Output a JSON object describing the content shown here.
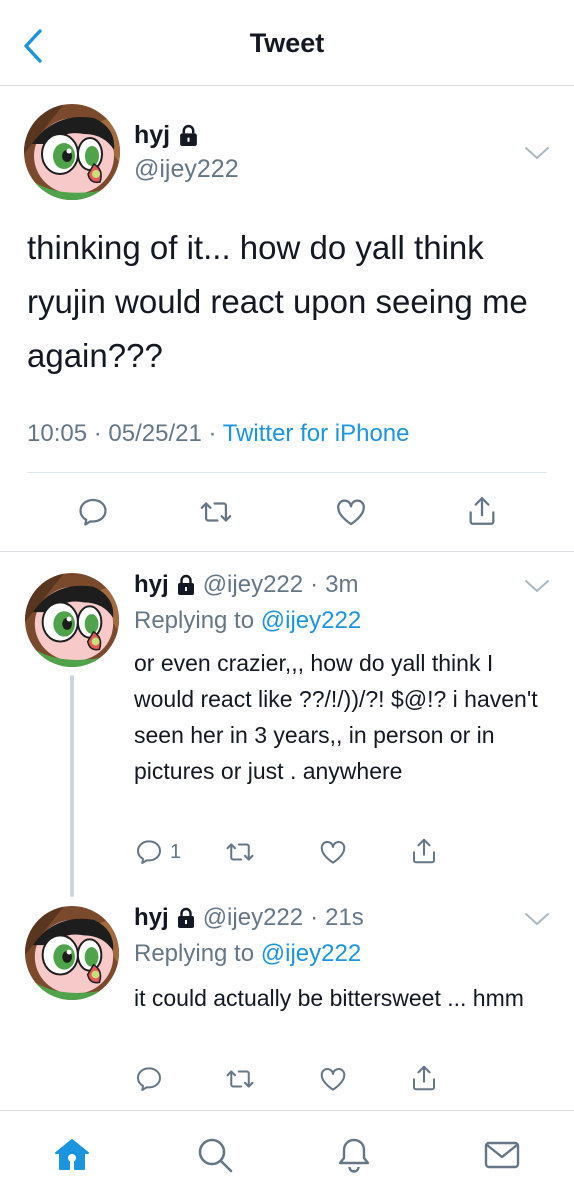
{
  "header": {
    "title": "Tweet"
  },
  "colors": {
    "accent": "#1b95e0",
    "text": "#141823",
    "muted": "#657786",
    "divider": "#d9dde0"
  },
  "main_tweet": {
    "name": "hyj",
    "handle": "@ijey222",
    "text": "thinking of it... how do yall think ryujin would react upon seeing me again???",
    "time": "10:05",
    "date": "05/25/21",
    "source": "Twitter for iPhone",
    "separator": "·"
  },
  "replies": [
    {
      "name": "hyj",
      "handle": "@ijey222",
      "age": "3m",
      "replying_label": "Replying to",
      "replying_to": "@ijey222",
      "text": "or even crazier,,, how do yall think I would react like ??/!/))/?! $@!? i haven't seen her in 3 years,, in person or in pictures or just . anywhere",
      "reply_count": "1"
    },
    {
      "name": "hyj",
      "handle": "@ijey222",
      "age": "21s",
      "replying_label": "Replying to",
      "replying_to": "@ijey222",
      "text": "it could actually be bittersweet ... hmm",
      "reply_count": ""
    }
  ],
  "icons": {
    "back": "chevron-left-icon",
    "lock": "lock-icon",
    "more": "chevron-down-icon",
    "reply": "reply-icon",
    "retweet": "retweet-icon",
    "like": "heart-icon",
    "share": "share-icon",
    "home": "home-icon",
    "search": "search-icon",
    "notifications": "bell-icon",
    "messages": "mail-icon"
  }
}
